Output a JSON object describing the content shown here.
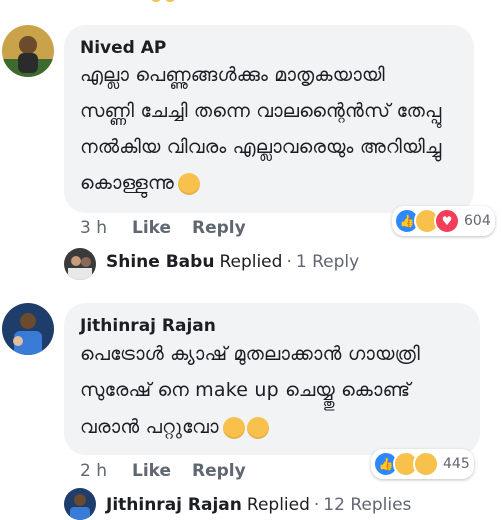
{
  "comments": [
    {
      "author": "Nived AP",
      "lines": [
        "എല്ലാ പെണ്ണുങ്ങൾക്കും മാതൃകയായി",
        "സണ്ണി ചേച്ചി തന്നെ വാലന്റൈൻസ് തേപ്പു",
        "നൽകിയ വിവരം എല്ലാവരെയും അറിയിച്ചു",
        "കൊള്ളുന്നു"
      ],
      "time": "3 h",
      "like_label": "Like",
      "reply_label": "Reply",
      "reaction_count": "604",
      "reply_summary": {
        "name": "Shine Babu",
        "label": "Replied",
        "separator": "·",
        "count": "1 Reply"
      }
    },
    {
      "author": "Jithinraj Rajan",
      "lines": [
        "പെട്രോൾ ക്യാഷ് മുതലാക്കാൻ ഗായത്രി",
        "സുരേഷ് നെ make up ചെയ്യ്തു കൊണ്ട്",
        "വരാൻ പറ്റുവോ"
      ],
      "time": "2 h",
      "like_label": "Like",
      "reply_label": "Reply",
      "reaction_count": "445",
      "reply_summary": {
        "name": "Jithinraj Rajan",
        "label": "Replied",
        "separator": "·",
        "count": "12 Replies"
      }
    }
  ],
  "colors": {
    "bubble": "#f2f3f5",
    "meta_text": "#606770",
    "like_blue": "#2d88ff",
    "love_red": "#f33e58",
    "haha_yellow": "#f7c14b"
  }
}
